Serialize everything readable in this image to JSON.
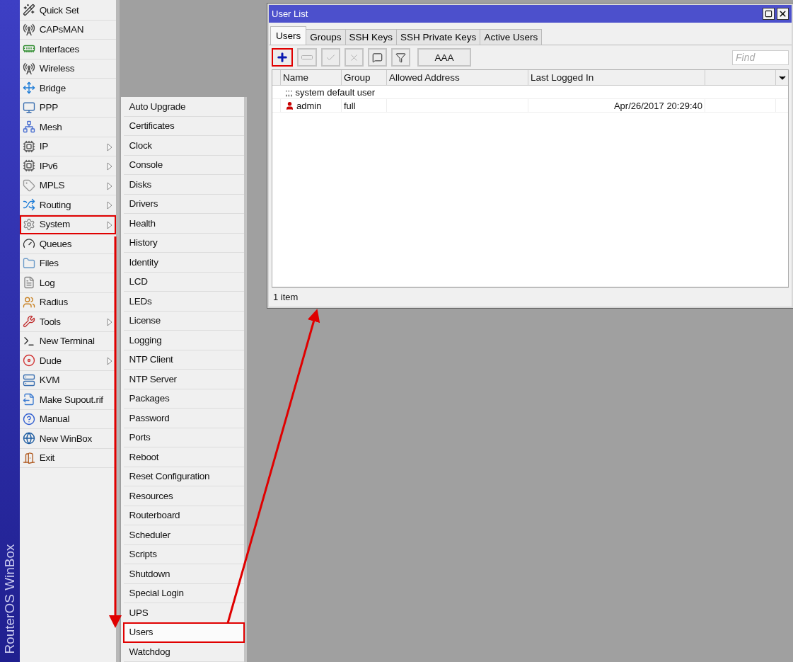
{
  "sidebar": {
    "brand": "RouterOS WinBox"
  },
  "main_menu": {
    "items": [
      {
        "label": "Quick Set",
        "has_submenu": false,
        "annotated": false
      },
      {
        "label": "CAPsMAN",
        "has_submenu": false,
        "annotated": false
      },
      {
        "label": "Interfaces",
        "has_submenu": false,
        "annotated": false
      },
      {
        "label": "Wireless",
        "has_submenu": false,
        "annotated": false
      },
      {
        "label": "Bridge",
        "has_submenu": false,
        "annotated": false
      },
      {
        "label": "PPP",
        "has_submenu": false,
        "annotated": false
      },
      {
        "label": "Mesh",
        "has_submenu": false,
        "annotated": false
      },
      {
        "label": "IP",
        "has_submenu": true,
        "annotated": false
      },
      {
        "label": "IPv6",
        "has_submenu": true,
        "annotated": false
      },
      {
        "label": "MPLS",
        "has_submenu": true,
        "annotated": false
      },
      {
        "label": "Routing",
        "has_submenu": true,
        "annotated": false
      },
      {
        "label": "System",
        "has_submenu": true,
        "annotated": true
      },
      {
        "label": "Queues",
        "has_submenu": false,
        "annotated": false
      },
      {
        "label": "Files",
        "has_submenu": false,
        "annotated": false
      },
      {
        "label": "Log",
        "has_submenu": false,
        "annotated": false
      },
      {
        "label": "Radius",
        "has_submenu": false,
        "annotated": false
      },
      {
        "label": "Tools",
        "has_submenu": true,
        "annotated": false
      },
      {
        "label": "New Terminal",
        "has_submenu": false,
        "annotated": false
      },
      {
        "label": "Dude",
        "has_submenu": true,
        "annotated": false
      },
      {
        "label": "KVM",
        "has_submenu": false,
        "annotated": false
      },
      {
        "label": "Make Supout.rif",
        "has_submenu": false,
        "annotated": false
      },
      {
        "label": "Manual",
        "has_submenu": false,
        "annotated": false
      },
      {
        "label": "New WinBox",
        "has_submenu": false,
        "annotated": false
      },
      {
        "label": "Exit",
        "has_submenu": false,
        "annotated": false
      }
    ]
  },
  "submenu": {
    "items": [
      {
        "label": "Auto Upgrade",
        "annotated": false
      },
      {
        "label": "Certificates",
        "annotated": false
      },
      {
        "label": "Clock",
        "annotated": false
      },
      {
        "label": "Console",
        "annotated": false
      },
      {
        "label": "Disks",
        "annotated": false
      },
      {
        "label": "Drivers",
        "annotated": false
      },
      {
        "label": "Health",
        "annotated": false
      },
      {
        "label": "History",
        "annotated": false
      },
      {
        "label": "Identity",
        "annotated": false
      },
      {
        "label": "LCD",
        "annotated": false
      },
      {
        "label": "LEDs",
        "annotated": false
      },
      {
        "label": "License",
        "annotated": false
      },
      {
        "label": "Logging",
        "annotated": false
      },
      {
        "label": "NTP Client",
        "annotated": false
      },
      {
        "label": "NTP Server",
        "annotated": false
      },
      {
        "label": "Packages",
        "annotated": false
      },
      {
        "label": "Password",
        "annotated": false
      },
      {
        "label": "Ports",
        "annotated": false
      },
      {
        "label": "Reboot",
        "annotated": false
      },
      {
        "label": "Reset Configuration",
        "annotated": false
      },
      {
        "label": "Resources",
        "annotated": false
      },
      {
        "label": "Routerboard",
        "annotated": false
      },
      {
        "label": "Scheduler",
        "annotated": false
      },
      {
        "label": "Scripts",
        "annotated": false
      },
      {
        "label": "Shutdown",
        "annotated": false
      },
      {
        "label": "Special Login",
        "annotated": false
      },
      {
        "label": "UPS",
        "annotated": false
      },
      {
        "label": "Users",
        "annotated": true
      },
      {
        "label": "Watchdog",
        "annotated": false
      }
    ]
  },
  "window": {
    "title": "User List",
    "tabs": [
      {
        "label": "Users",
        "selected": true
      },
      {
        "label": "Groups",
        "selected": false
      },
      {
        "label": "SSH Keys",
        "selected": false
      },
      {
        "label": "SSH Private Keys",
        "selected": false
      },
      {
        "label": "Active Users",
        "selected": false
      }
    ],
    "toolbar": {
      "buttons": [
        {
          "kind": "add",
          "disabled": false,
          "annotated": true
        },
        {
          "kind": "remove",
          "disabled": true,
          "annotated": false
        },
        {
          "kind": "enable",
          "disabled": true,
          "annotated": false
        },
        {
          "kind": "disable",
          "disabled": true,
          "annotated": false
        },
        {
          "kind": "comment",
          "disabled": false,
          "annotated": false
        },
        {
          "kind": "filter",
          "disabled": false,
          "annotated": false
        },
        {
          "kind": "text",
          "label": "AAA",
          "disabled": false,
          "annotated": false
        }
      ],
      "search": {
        "placeholder": "Find"
      }
    },
    "table": {
      "columns": [
        "Name",
        "Group",
        "Allowed Address",
        "Last Logged In"
      ],
      "rows": [
        {
          "kind": "comment",
          "text": ";;; system default user"
        },
        {
          "kind": "user",
          "name": "admin",
          "group": "full",
          "last_logged_in": "Apr/26/2017 20:29:40"
        }
      ]
    },
    "status_bar": "1 item"
  }
}
